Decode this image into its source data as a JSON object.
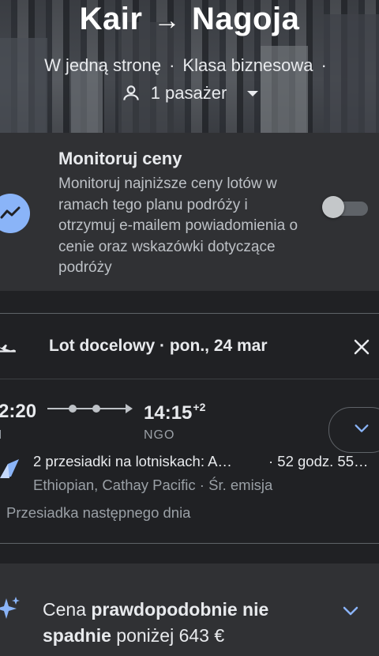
{
  "header": {
    "origin": "Kair",
    "arrow": "→",
    "destination": "Nagoja",
    "trip_type": "W jedną stronę",
    "separator": "·",
    "cabin_class": "Klasa biznesowa",
    "passengers": "1 pasażer"
  },
  "monitor": {
    "title": "Monitoruj ceny",
    "description": "Monitoruj najniższe ceny lotów w ramach tego planu podróży i otrzymuj e-mailem powiadomienia o cenie oraz wskazówki dotyczące podróży",
    "toggle_on": false
  },
  "flight": {
    "heading": "Lot docelowy · pon., 24 mar",
    "departure_time": "2:20",
    "arrival_time": "14:15",
    "arrival_day_offset": "+2",
    "departure_code": "I",
    "arrival_code": "NGO",
    "stops": "2 przesiadki na lotniskach: A…",
    "duration": "· 52 godz. 55…",
    "airlines": "Ethiopian, Cathay Pacific · Śr. emisja",
    "note": "Przesiadka następnego dnia"
  },
  "price_insight": {
    "prefix": "Cena ",
    "bold1": "prawdopodobnie nie spadnie",
    "suffix": " poniżej 643 €"
  },
  "colors": {
    "background": "#202124",
    "card": "#303134",
    "accent": "#8ab4f8",
    "text": "#e8eaed",
    "muted": "#9aa0a6"
  },
  "icons": [
    "person-icon",
    "caret-down-icon",
    "trend-icon",
    "plane-icon",
    "close-icon",
    "chevron-down-icon",
    "airline-logo",
    "sparkle-icon"
  ]
}
